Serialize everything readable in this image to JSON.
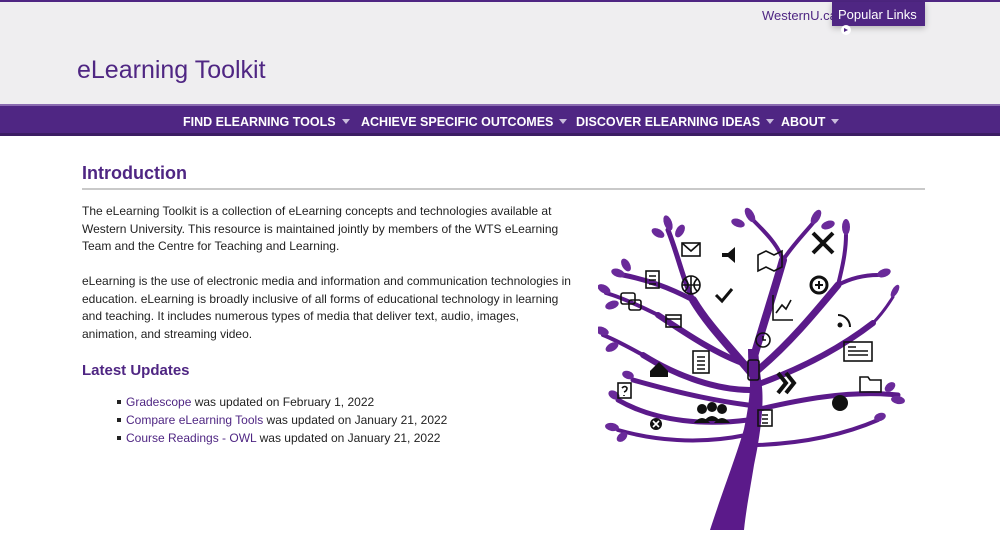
{
  "header": {
    "westernu_link": "WesternU.ca",
    "popular_links": "Popular Links",
    "site_title": "eLearning Toolkit"
  },
  "nav": {
    "items": [
      {
        "label": "FIND ELEARNING TOOLS"
      },
      {
        "label": "ACHIEVE SPECIFIC OUTCOMES"
      },
      {
        "label": "DISCOVER ELEARNING IDEAS"
      },
      {
        "label": "ABOUT"
      }
    ]
  },
  "main": {
    "heading": "Introduction",
    "paragraph1": "The eLearning Toolkit is a collection of eLearning concepts and technologies available at Western University. This resource is maintained jointly by members of the WTS eLearning Team and the Centre for Teaching and Learning.",
    "paragraph2": "eLearning is the use of electronic media and information and communication technologies in education. eLearning is broadly inclusive of all forms of educational technology in learning and teaching. It includes numerous types of media that deliver text, audio, images, animation, and streaming video.",
    "updates_heading": "Latest Updates",
    "updates": [
      {
        "link": "Gradescope",
        "text": " was updated on February 1, 2022"
      },
      {
        "link": "Compare eLearning Tools",
        "text": " was updated on January 21, 2022"
      },
      {
        "link": "Course Readings - OWL",
        "text": " was updated on January 21, 2022"
      }
    ]
  },
  "illustration": {
    "name": "elearning-tree",
    "color": "#5b1a8a",
    "icons": [
      "email-icon",
      "speaker-icon",
      "map-icon",
      "tools-icon",
      "globe-icon",
      "checkmark-icon",
      "document-icon",
      "chat-icon",
      "calendar-icon",
      "chart-icon",
      "add-icon",
      "rss-icon",
      "clock-icon",
      "home-icon",
      "list-icon",
      "phone-icon",
      "forward-icon",
      "newspaper-icon",
      "folder-icon",
      "help-icon",
      "group-icon",
      "checklist-icon",
      "gear-icon",
      "close-icon"
    ]
  },
  "colors": {
    "brand_purple": "#4f2683",
    "masthead_bg": "#efeef0"
  }
}
